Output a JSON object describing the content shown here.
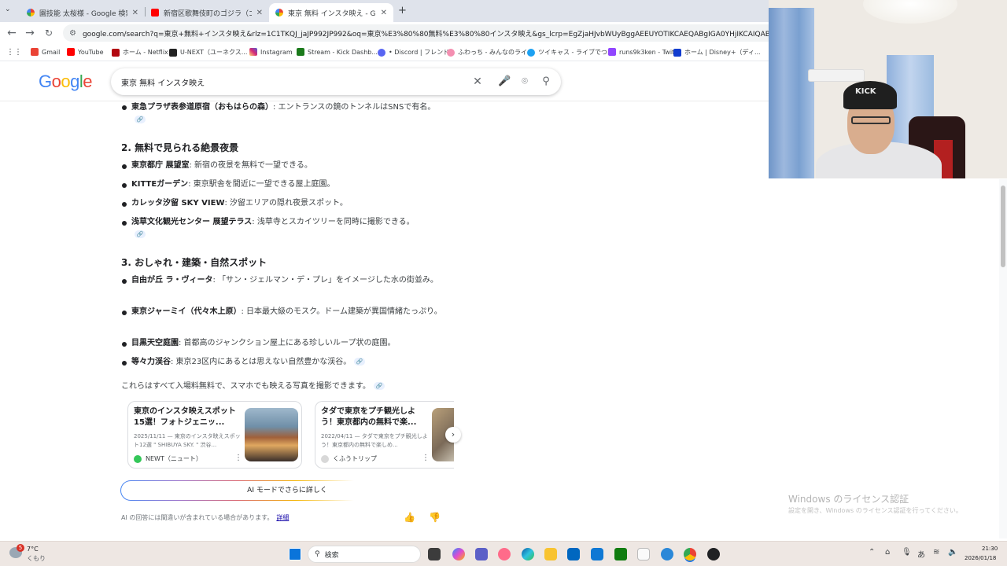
{
  "browser": {
    "tabs": [
      {
        "title": "園技能 太桜様 - Google 検索",
        "active": false
      },
      {
        "title": "新宿区歌舞伎町のゴジラ（ゴジラヘ",
        "active": false
      },
      {
        "title": "東京 無料 インスタ映え - Google",
        "active": true
      }
    ],
    "new_tab": "+",
    "url": "google.com/search?q=東京+無料+インスタ映え&rlz=1C1TKQJ_jaJP992JP992&oq=東京%E3%80%80無料%E3%80%80インスタ映え&gs_lcrp=EgZjaHJvbWUyBggAEEUYOTIKCAEQABgIGA0YHjIKCAIQABgIGA0YHjIHCAM",
    "bookmarks": [
      "Gmail",
      "YouTube",
      "ホーム - Netflix",
      "U-NEXT（ユーネクス...",
      "Instagram",
      "Stream - Kick Dashb...",
      "• Discord | フレンド",
      "ふわっち - みんなのライ...",
      "ツイキャス - ライブでつ...",
      "runs9k3ken - Twitch",
      "ホーム | Disney+（ディ..."
    ]
  },
  "google": {
    "logo": "Google",
    "query": "東京 無料 インスタ映え"
  },
  "answer": {
    "top_item": {
      "bold": "東急プラザ表参道原宿（おもはらの森）",
      "text": ": エントランスの鏡のトンネルはSNSで有名。"
    },
    "section2": {
      "heading": "2. 無料で見られる絶景夜景",
      "items": [
        {
          "bold": "東京都庁 展望室",
          "text": ": 新宿の夜景を無料で一望できる。"
        },
        {
          "bold": "KITTEガーデン",
          "text": ": 東京駅舎を間近に一望できる屋上庭園。"
        },
        {
          "bold": "カレッタ汐留 SKY VIEW",
          "text": ": 汐留エリアの隠れ夜景スポット。"
        },
        {
          "bold": "浅草文化観光センター 展望テラス",
          "text": ": 浅草寺とスカイツリーを同時に撮影できる。"
        }
      ]
    },
    "section3": {
      "heading": "3. おしゃれ・建築・自然スポット",
      "items": [
        {
          "bold": "自由が丘 ラ・ヴィータ",
          "text": ": 「サン・ジェルマン・デ・プレ」をイメージした水の街並み。"
        },
        {
          "bold": "東京ジャーミイ（代々木上原）",
          "text": ": 日本最大級のモスク。ドーム建築が異国情緒たっぷり。"
        },
        {
          "bold": "目黒天空庭園",
          "text": ": 首都高のジャンクション屋上にある珍しいループ状の庭園。"
        },
        {
          "bold": "等々力渓谷",
          "text": ": 東京23区内にあるとは思えない自然豊かな渓谷。"
        }
      ]
    },
    "summary": "これらはすべて入場料無料で、スマホでも映える写真を撮影できます。",
    "link_icon": "🔗",
    "cards": [
      {
        "title": "東京のインスタ映えスポット15選！フォトジェニッ...",
        "desc": "2025/11/11 — 東京のインスタ映えスポット12選 \" SHIBUYA SKY. \" 渋谷...",
        "source": "NEWT（ニュート）"
      },
      {
        "title": "タダで東京をプチ観光しよう！東京都内の無料で楽...",
        "desc": "2022/04/11 — タダで東京をプチ観光しよう！東京都内の無料で楽しめ...",
        "source": "くふうトリップ"
      }
    ],
    "ai_mode_button": "AI モードでさらに詳しく",
    "disclaimer": "AI の回答には間違いが含まれている場合があります。",
    "disclaimer_link": "詳細"
  },
  "watermark": {
    "line1": "Windows のライセンス認証",
    "line2": "設定を開き、Windows のライセンス認証を行ってください。"
  },
  "taskbar": {
    "weather_temp": "7°C",
    "weather_text": "くもり",
    "weather_badge": "5",
    "search_placeholder": "検索",
    "time": "21:30",
    "date": "2026/01/18",
    "ime": "あ"
  },
  "colors": {
    "google_blue": "#4285F4",
    "google_red": "#EA4335",
    "google_yellow": "#FBBC05",
    "google_green": "#34A853"
  }
}
